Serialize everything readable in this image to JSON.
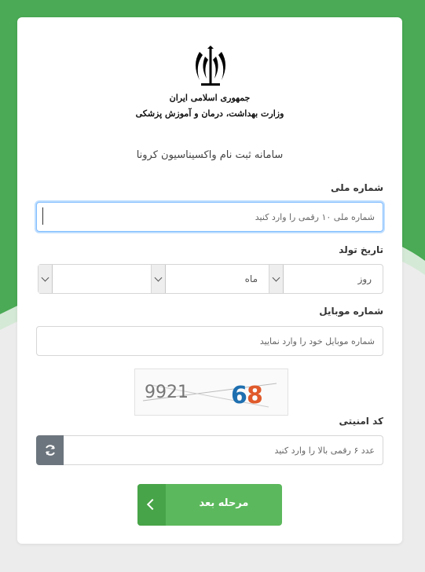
{
  "logo": {
    "emblem": "iran-emblem-icon",
    "line1": "جمهوری اسلامی ایران",
    "line2": "وزارت بهداشت، درمان و آموزش پزشکی"
  },
  "subtitle": "سامانه ثبت نام واکسیناسیون کرونا",
  "national_code": {
    "label": "شماره ملی",
    "placeholder": "شماره ملی ۱۰ رقمی را وارد کنید",
    "value": ""
  },
  "birth_date": {
    "label": "تاریخ تولد",
    "day_placeholder": "روز",
    "month_placeholder": "ماه",
    "year_placeholder": ""
  },
  "mobile": {
    "label": "شماره موبایل",
    "placeholder": "شماره موبایل خود را وارد نمایید",
    "value": ""
  },
  "captcha": {
    "image_text": "992168",
    "label": "کد امنیتی",
    "placeholder": "عدد ۶ رقمی بالا را وارد کنید",
    "refresh_icon": "refresh-icon"
  },
  "next_button": {
    "label": "مرحله بعد",
    "icon": "chevron-left-icon"
  },
  "colors": {
    "primary": "#5cb85c",
    "primary_dark": "#48a448",
    "focus": "#80bdff",
    "refresh_bg": "#6c757d"
  }
}
